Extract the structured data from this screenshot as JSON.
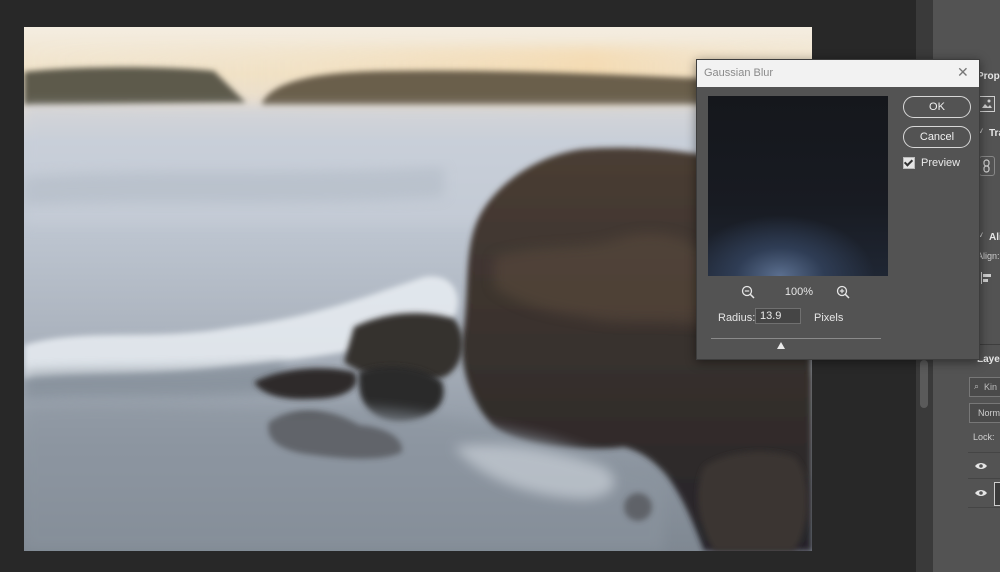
{
  "dialog": {
    "title": "Gaussian Blur",
    "close_symbol": "✕",
    "ok_label": "OK",
    "cancel_label": "Cancel",
    "preview_label": "Preview",
    "preview_checked": true,
    "zoom_percent": "100%",
    "radius_label": "Radius:",
    "radius_value": "13.9",
    "radius_unit": "Pixels"
  },
  "right_panel": {
    "properties_tab": "Prope",
    "transform_section": "Tra",
    "align_section": "Ali",
    "align_label": "Align:",
    "layers_tab": "Layer",
    "layers_search_placeholder": "Kin",
    "blend_mode": "Norm",
    "lock_label": "Lock:"
  },
  "icons": {
    "close": "close-icon",
    "zoom_out": "zoom-out-icon",
    "zoom_in": "zoom-in-icon",
    "visibility": "eye-icon",
    "image": "image-icon",
    "link": "link-icon"
  },
  "colors": {
    "panel_bg": "#535353",
    "workspace_bg": "#282828",
    "dialog_titlebar": "#f2f2f2"
  }
}
